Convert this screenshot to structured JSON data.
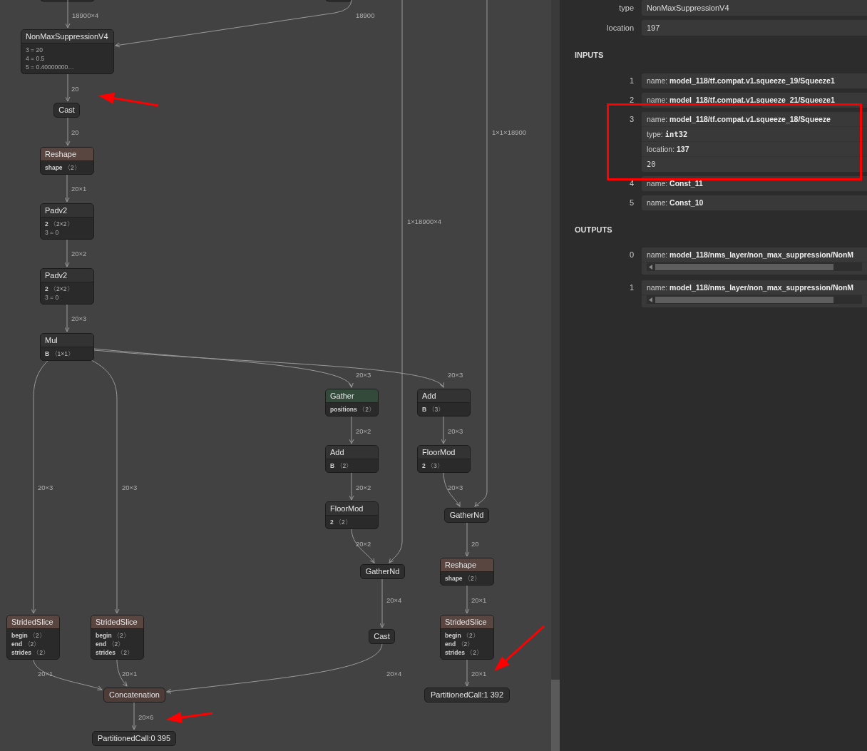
{
  "graph": {
    "nodes": [
      {
        "kind": "default",
        "title": "NonMaxSuppressionV4",
        "attributes": [
          {
            "kind": "attribute",
            "text": "3 = 20"
          },
          {
            "kind": "attribute",
            "text": "4 = 0.5"
          },
          {
            "kind": "attribute",
            "text": "5 = 0.40000000…"
          }
        ]
      },
      {
        "kind": "default",
        "title": "Cast"
      },
      {
        "kind": "shape",
        "title": "Reshape",
        "attributes": [
          {
            "kind": "input",
            "name": "shape",
            "value": "〈2〉"
          }
        ]
      },
      {
        "kind": "default",
        "title": "Padv2",
        "attributes": [
          {
            "kind": "input",
            "name": "2",
            "value": "〈2×2〉"
          },
          {
            "kind": "attribute",
            "text": "3 = 0"
          }
        ]
      },
      {
        "kind": "default",
        "title": "Padv2",
        "attributes": [
          {
            "kind": "input",
            "name": "2",
            "value": "〈2×2〉"
          },
          {
            "kind": "attribute",
            "text": "3 = 0"
          }
        ]
      },
      {
        "kind": "default",
        "title": "Mul",
        "attributes": [
          {
            "kind": "input",
            "name": "B",
            "value": "〈1×1〉"
          }
        ]
      },
      {
        "kind": "transform",
        "title": "Gather",
        "attributes": [
          {
            "kind": "input",
            "name": "positions",
            "value": "〈2〉"
          }
        ]
      },
      {
        "kind": "default",
        "title": "Add",
        "attributes": [
          {
            "kind": "input",
            "name": "B",
            "value": "〈3〉"
          }
        ]
      },
      {
        "kind": "default",
        "title": "Add",
        "attributes": [
          {
            "kind": "input",
            "name": "B",
            "value": "〈2〉"
          }
        ]
      },
      {
        "kind": "default",
        "title": "FloorMod",
        "attributes": [
          {
            "kind": "input",
            "name": "2",
            "value": "〈3〉"
          }
        ]
      },
      {
        "kind": "default",
        "title": "FloorMod",
        "attributes": [
          {
            "kind": "input",
            "name": "2",
            "value": "〈2〉"
          }
        ]
      },
      {
        "kind": "default",
        "title": "GatherNd"
      },
      {
        "kind": "default",
        "title": "GatherNd"
      },
      {
        "kind": "shape",
        "title": "Reshape",
        "attributes": [
          {
            "kind": "input",
            "name": "shape",
            "value": "〈2〉"
          }
        ]
      },
      {
        "kind": "shape",
        "title": "StridedSlice",
        "attributes": [
          {
            "kind": "input",
            "name": "begin",
            "value": "〈2〉"
          },
          {
            "kind": "input",
            "name": "end",
            "value": "〈2〉"
          },
          {
            "kind": "input",
            "name": "strides",
            "value": "〈2〉"
          }
        ]
      },
      {
        "kind": "shape",
        "title": "StridedSlice",
        "attributes": [
          {
            "kind": "input",
            "name": "begin",
            "value": "〈2〉"
          },
          {
            "kind": "input",
            "name": "end",
            "value": "〈2〉"
          },
          {
            "kind": "input",
            "name": "strides",
            "value": "〈2〉"
          }
        ]
      },
      {
        "kind": "default",
        "title": "Cast"
      },
      {
        "kind": "shape",
        "title": "StridedSlice",
        "attributes": [
          {
            "kind": "input",
            "name": "begin",
            "value": "〈2〉"
          },
          {
            "kind": "input",
            "name": "end",
            "value": "〈2〉"
          },
          {
            "kind": "input",
            "name": "strides",
            "value": "〈2〉"
          }
        ]
      },
      {
        "kind": "shape",
        "title": "Concatenation"
      },
      {
        "kind": "default",
        "title": "PartitionedCall:0 395"
      },
      {
        "kind": "default",
        "title": "PartitionedCall:1 392"
      }
    ],
    "edge_labels": [
      "18900×4",
      "18900",
      "20",
      "20",
      "1×1×18900",
      "1×18900×4",
      "20×1",
      "20×2",
      "20×3",
      "20×3",
      "20×3",
      "20×2",
      "20×3",
      "20×3",
      "20×3",
      "20×2",
      "20×3",
      "20",
      "20×2",
      "20×4",
      "20×1",
      "20×1",
      "20×1",
      "20×4",
      "20×1",
      "20×6"
    ]
  },
  "properties": {
    "rows": [
      {
        "label": "type",
        "value": "NonMaxSuppressionV4"
      },
      {
        "label": "location",
        "value": "197"
      }
    ]
  },
  "inputs": {
    "heading": "INPUTS",
    "items": [
      {
        "index": "1",
        "fields": [
          {
            "kind": "name",
            "label": "name:",
            "value": "model_118/tf.compat.v1.squeeze_19/Squeeze1"
          }
        ]
      },
      {
        "index": "2",
        "fields": [
          {
            "kind": "name",
            "label": "name:",
            "value": "model_118/tf.compat.v1.squeeze_21/Squeeze1"
          }
        ]
      },
      {
        "index": "3",
        "fields": [
          {
            "kind": "name",
            "label": "name:",
            "value": "model_118/tf.compat.v1.squeeze_18/Squeeze"
          },
          {
            "kind": "type",
            "label": "type:",
            "value": "int32"
          },
          {
            "kind": "name",
            "label": "location:",
            "value": "137"
          },
          {
            "kind": "data",
            "value": "20"
          }
        ]
      },
      {
        "index": "4",
        "fields": [
          {
            "kind": "name",
            "label": "name:",
            "value": "Const_11"
          }
        ]
      },
      {
        "index": "5",
        "fields": [
          {
            "kind": "name",
            "label": "name:",
            "value": "Const_10"
          }
        ]
      }
    ]
  },
  "outputs": {
    "heading": "OUTPUTS",
    "items": [
      {
        "index": "0",
        "fields": [
          {
            "kind": "name",
            "label": "name:",
            "value": "model_118/nms_layer/non_max_suppression/NonM"
          }
        ]
      },
      {
        "index": "1",
        "fields": [
          {
            "kind": "name",
            "label": "name:",
            "value": "model_118/nms_layer/non_max_suppression/NonM"
          }
        ]
      }
    ]
  }
}
